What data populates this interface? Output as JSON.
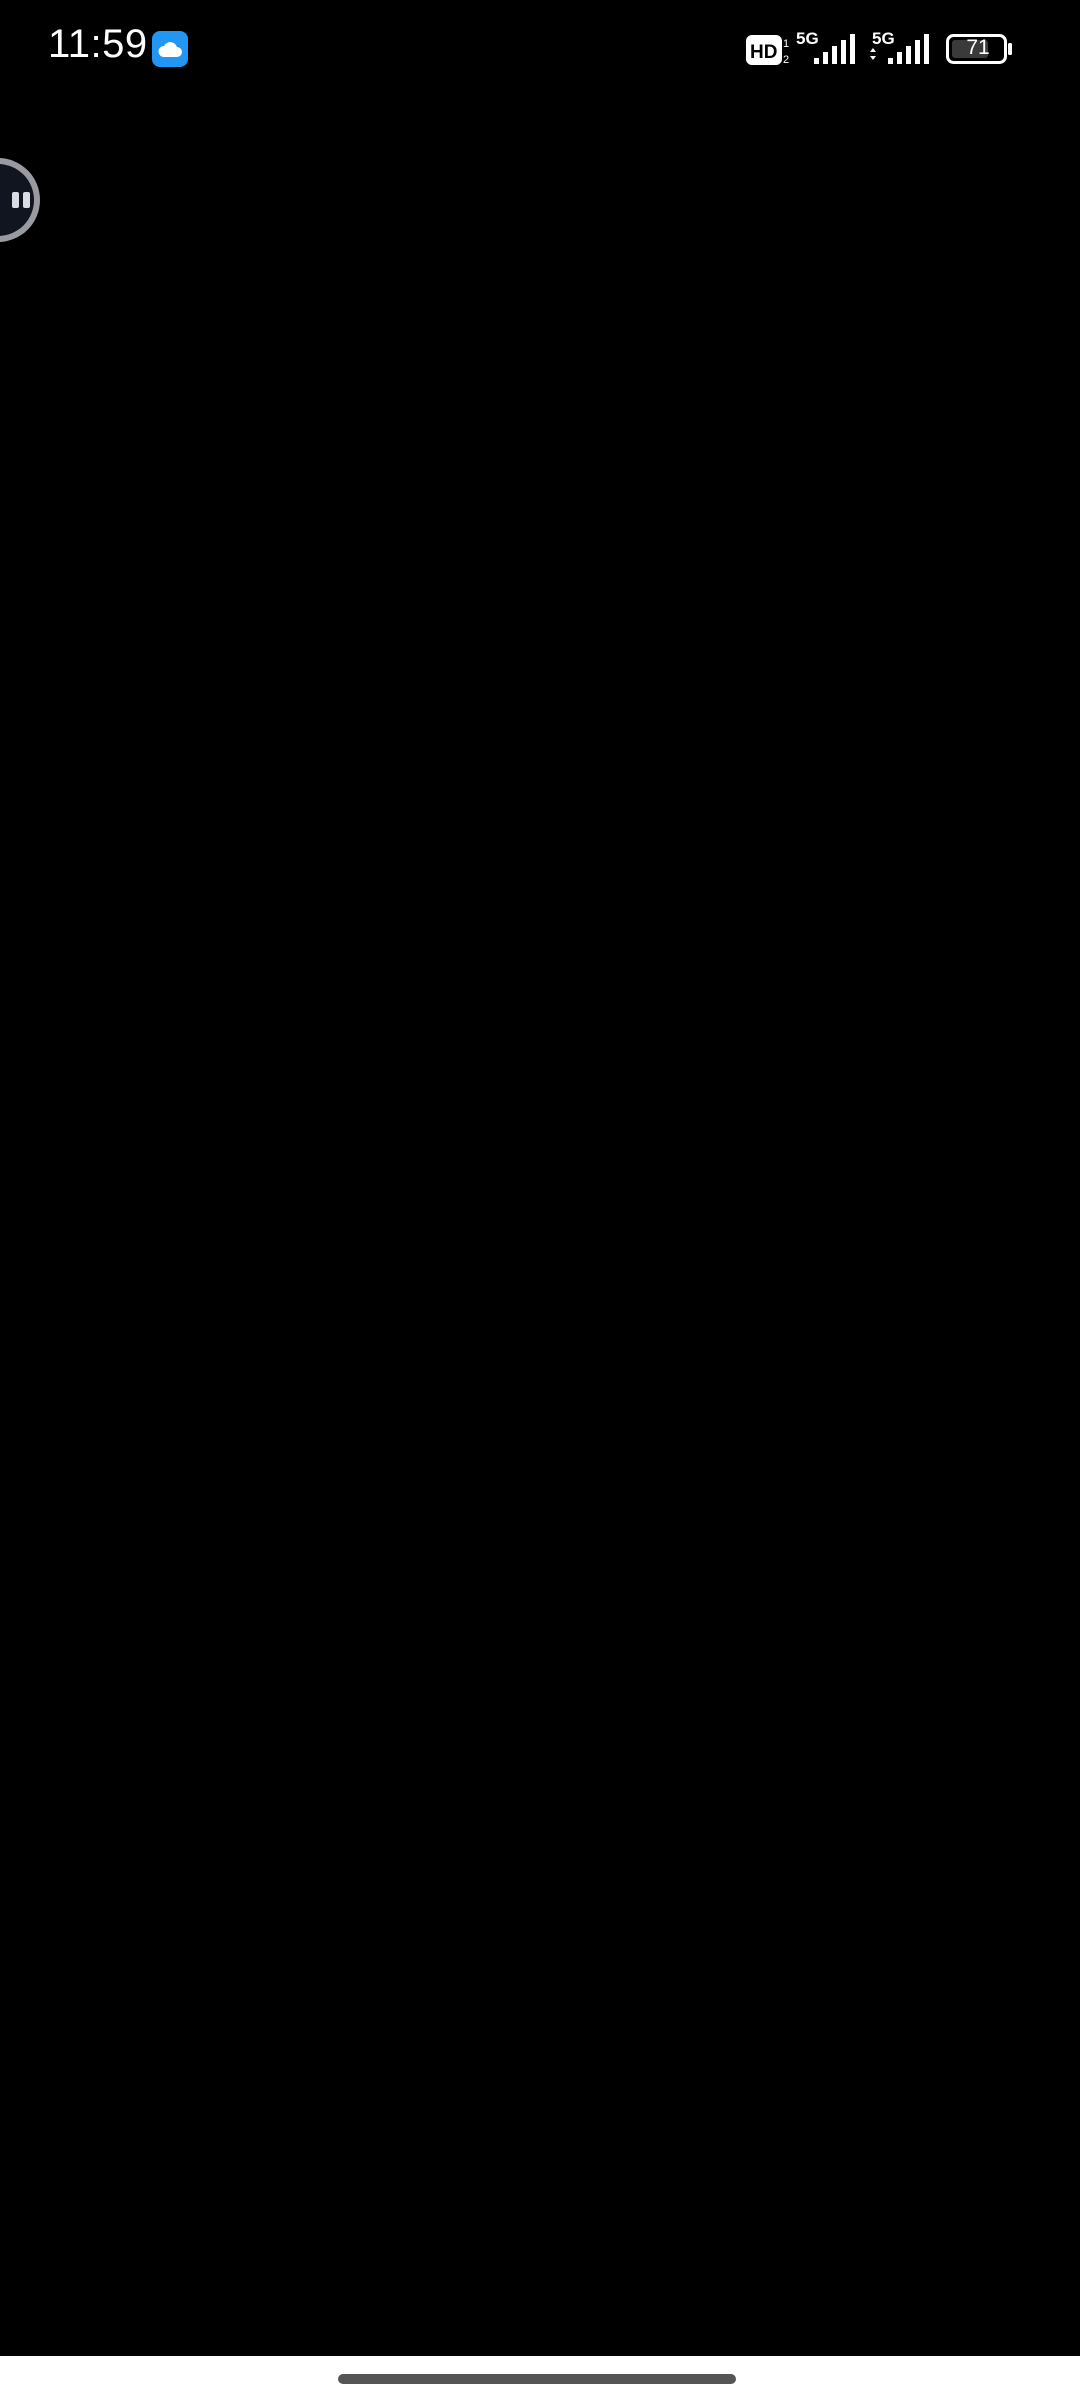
{
  "status_bar": {
    "time": "11:59",
    "notification_icons": [
      "cloud-app-icon"
    ],
    "network": {
      "hd_label": "HD",
      "hd_sub": "2",
      "sim1_type": "5G",
      "sim2_type": "5G"
    },
    "battery_level": "71"
  },
  "floating_bubble": {
    "icon": "assistant-face-icon"
  },
  "colors": {
    "background": "#000000",
    "cloud_app_accent": "#2196f3",
    "gesture_handle": "#555555",
    "nav_area": "#ffffff"
  }
}
